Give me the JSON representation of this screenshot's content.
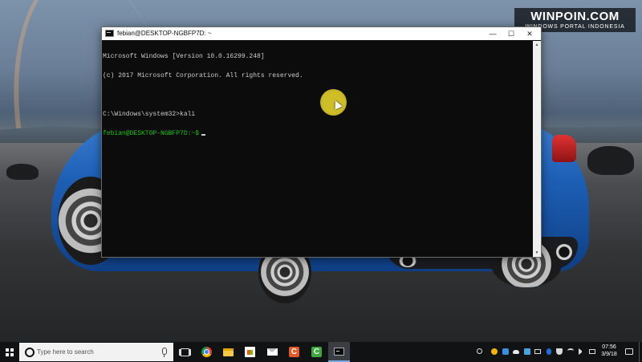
{
  "watermark": {
    "title": "WINPOIN.COM",
    "subtitle": "WINDOWS PORTAL INDONESIA"
  },
  "console": {
    "title": "febian@DESKTOP-NGBFP7D: ~",
    "controls": {
      "minimize": "—",
      "maximize": "☐",
      "close": "✕"
    },
    "lines": {
      "line1": "Microsoft Windows [Version 10.0.16299.248]",
      "line2": "(c) 2017 Microsoft Corporation. All rights reserved.",
      "line3": "",
      "line4": "C:\\Windows\\system32>kali",
      "prompt": "febian@DESKTOP-NGBFP7D:~$"
    },
    "prompt_color": "#16c60c",
    "text_color": "#cccccc"
  },
  "taskbar": {
    "search_placeholder": "Type here to search",
    "pinned_apps": [
      "task-view",
      "chrome",
      "file-explorer",
      "store",
      "mail",
      "camtasia-recorder",
      "camtasia-studio",
      "command-prompt"
    ],
    "app_letters": {
      "camtasia_recorder": "C",
      "camtasia_studio": "C"
    },
    "tray_icons": [
      "people",
      "chrome-sync",
      "network-share",
      "onedrive",
      "photos",
      "battery",
      "bluetooth",
      "security",
      "wifi",
      "volume",
      "keyboard"
    ],
    "clock": {
      "time": "07:56",
      "date": "3/9/18"
    }
  }
}
